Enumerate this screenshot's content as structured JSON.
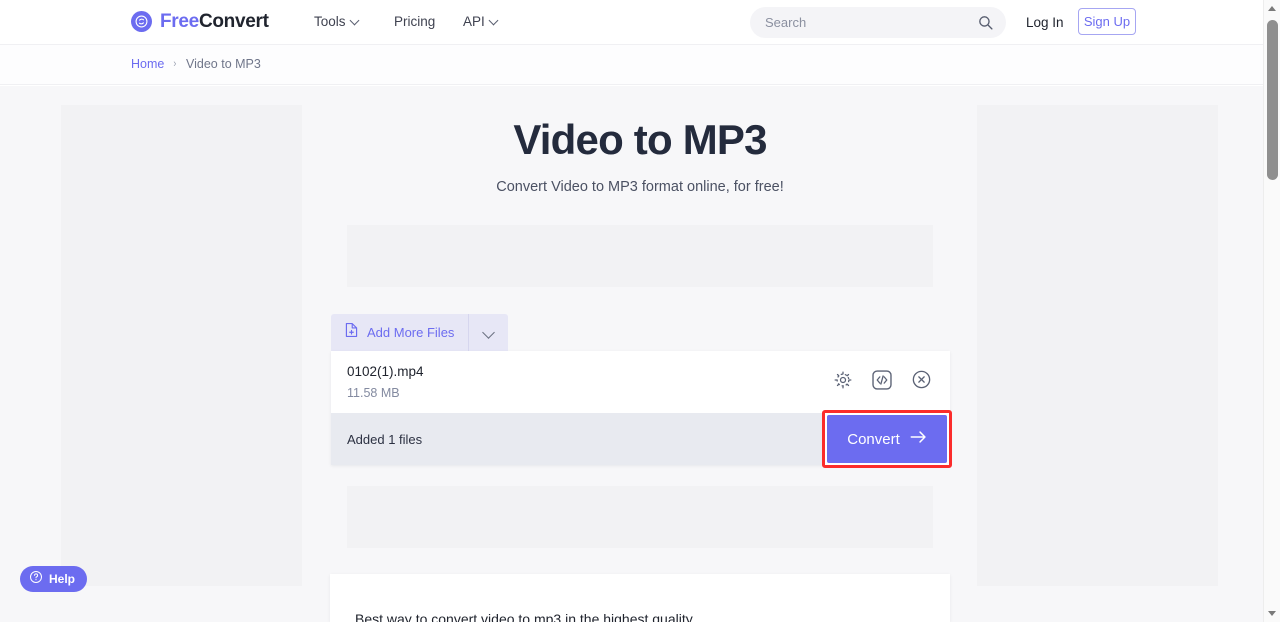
{
  "navbar": {
    "logo": {
      "icon": "refresh-circle-icon",
      "text_primary": "Free",
      "text_secondary": "Convert"
    },
    "links": [
      {
        "label": "Tools",
        "has_dropdown": true
      },
      {
        "label": "Pricing",
        "has_dropdown": false
      },
      {
        "label": "API",
        "has_dropdown": true
      }
    ],
    "search": {
      "placeholder": "Search",
      "value": "",
      "icon": "search-icon"
    },
    "login_label": "Log In",
    "signup_label": "Sign Up"
  },
  "breadcrumb": {
    "home_label": "Home",
    "separator": "›",
    "current_label": "Video to MP3"
  },
  "main": {
    "title": "Video to MP3",
    "subtitle": "Convert Video to MP3 format online, for free!",
    "add_files": {
      "icon": "file-plus-icon",
      "label": "Add More Files",
      "dropdown_icon": "chevron-down-icon"
    },
    "file": {
      "name": "0102(1).mp4",
      "size": "11.58 MB",
      "actions": [
        {
          "icon": "gear-icon",
          "name": "file-settings"
        },
        {
          "icon": "code-icon",
          "name": "file-embed-code"
        },
        {
          "icon": "close-circle-icon",
          "name": "file-remove"
        }
      ]
    },
    "footer": {
      "status_text": "Added 1 files",
      "convert_label": "Convert",
      "convert_arrow_icon": "arrow-right-icon"
    },
    "article_heading": "Best way to convert video to mp3 in the highest quality"
  },
  "help_widget": {
    "icon": "question-circle-icon",
    "label": "Help"
  },
  "scrollbar": {
    "up_icon": "arrow-up-icon",
    "down_icon": "arrow-down-icon"
  },
  "colors": {
    "accent_purple": "#6c6cf0",
    "tab_lavender": "#e7e7f6",
    "highlight_red": "#fb2c2c",
    "footer_gray": "#e8eaf0",
    "page_bg": "#f7f7f9",
    "ad_gray": "#f2f2f4",
    "heading_dark": "#242b3d"
  }
}
